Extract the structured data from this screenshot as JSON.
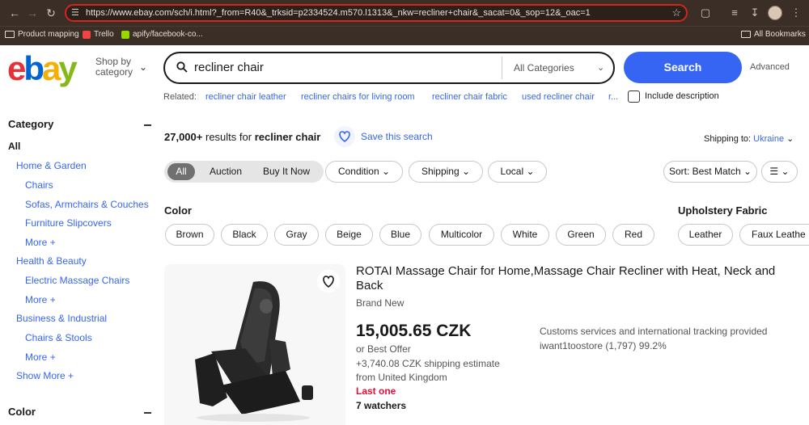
{
  "browser": {
    "url": "https://www.ebay.com/sch/i.html?_from=R40&_trksid=p2334524.m570.l1313&_nkw=recliner+chair&_sacat=0&_sop=12&_oac=1",
    "bookmarks": [
      "Product mapping",
      "Trello",
      "apify/facebook-co...",
      "All Bookmarks"
    ]
  },
  "header": {
    "shop_by_line1": "Shop by",
    "shop_by_line2": "category",
    "search_value": "recliner chair",
    "category": "All Categories",
    "search_button": "Search",
    "advanced": "Advanced"
  },
  "related": {
    "label": "Related:",
    "links": [
      "recliner chair leather",
      "recliner chairs for living room",
      "recliner chair fabric",
      "used recliner chair",
      "r..."
    ],
    "include_description": "Include description"
  },
  "sidebar": {
    "category_title": "Category",
    "all": "All",
    "items": [
      "Home & Garden",
      "Chairs",
      "Sofas, Armchairs & Couches",
      "Furniture Slipcovers",
      "More",
      "Health & Beauty",
      "Electric Massage Chairs",
      "More",
      "Business & Industrial",
      "Chairs & Stools",
      "More",
      "Show More"
    ],
    "color_title": "Color"
  },
  "results": {
    "count": "27,000+",
    "results_for": "results for",
    "query": "recliner chair",
    "save_search": "Save this search",
    "shipping_to_label": "Shipping to:",
    "shipping_to_country": "Ukraine"
  },
  "filters": {
    "tabs": [
      "All",
      "Auction",
      "Buy It Now"
    ],
    "dropdowns": [
      "Condition",
      "Shipping",
      "Local"
    ],
    "sort": "Sort: Best Match"
  },
  "facets": {
    "color_title": "Color",
    "colors": [
      "Brown",
      "Black",
      "Gray",
      "Beige",
      "Blue",
      "Multicolor",
      "White",
      "Green",
      "Red"
    ],
    "upholstery_title": "Upholstery Fabric",
    "upholstery": [
      "Leather",
      "Faux Leathe"
    ]
  },
  "listing": {
    "title": "ROTAI Massage Chair for Home,Massage Chair Recliner with Heat, Neck and Back",
    "condition": "Brand New",
    "price": "15,005.65 CZK",
    "best_offer": "or Best Offer",
    "shipping": "+3,740.08 CZK shipping estimate",
    "from": "from United Kingdom",
    "last_one": "Last one",
    "watchers": "7 watchers",
    "customs": "Customs services and international tracking provided",
    "seller": "iwant1toostore (1,797) 99.2%"
  },
  "colors": {
    "ebay_red": "#e53238",
    "ebay_blue": "#0064d2",
    "ebay_yellow": "#f5af02",
    "ebay_green": "#86b817",
    "accent": "#3665f3",
    "urgent": "#e0103a"
  }
}
